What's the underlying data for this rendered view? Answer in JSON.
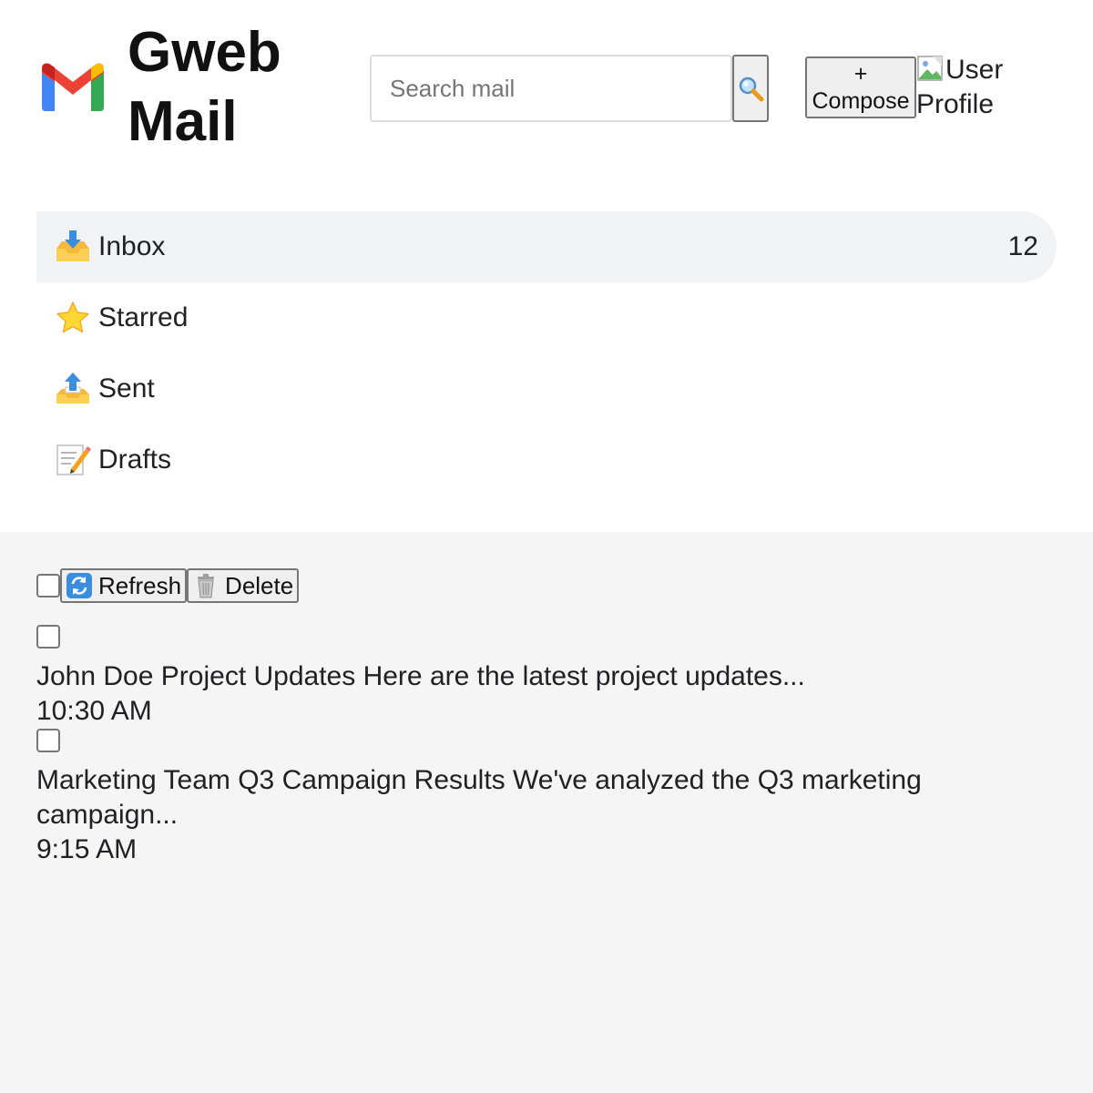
{
  "app": {
    "brand": "Gweb Mail"
  },
  "search": {
    "placeholder": "Search mail"
  },
  "compose": {
    "plus": "+",
    "label": "Compose"
  },
  "profile": {
    "alt": "User Profile"
  },
  "nav": {
    "items": [
      {
        "label": "Inbox",
        "icon": "inbox-tray-icon",
        "count": "12",
        "active": true
      },
      {
        "label": "Starred",
        "icon": "star-icon"
      },
      {
        "label": "Sent",
        "icon": "outbox-tray-icon"
      },
      {
        "label": "Drafts",
        "icon": "memo-icon"
      }
    ]
  },
  "toolbar": {
    "refresh": "Refresh",
    "delete": "Delete"
  },
  "emails": [
    {
      "sender": "John Doe",
      "subject": "Project Updates",
      "preview": "Here are the latest project updates...",
      "time": "10:30 AM"
    },
    {
      "sender": "Marketing Team",
      "subject": "Q3 Campaign Results",
      "preview": "We've analyzed the Q3 marketing campaign...",
      "time": "9:15 AM"
    }
  ],
  "colors": {
    "active_nav_bg": "#f1f3f4",
    "page_bg": "#f5f5f5",
    "logo_red": "#ea4335",
    "logo_blue": "#4285f4",
    "logo_green": "#34a853",
    "logo_yellow": "#fbbc04"
  }
}
